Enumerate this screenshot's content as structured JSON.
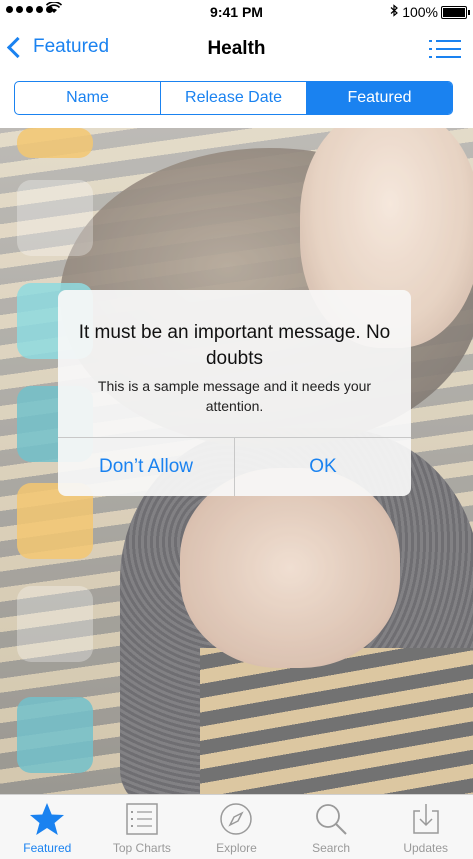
{
  "status_bar": {
    "time": "9:41 PM",
    "battery": "100%"
  },
  "nav": {
    "back_label": "Featured",
    "title": "Health"
  },
  "segments": [
    "Name",
    "Release Date",
    "Featured"
  ],
  "alert": {
    "title": "It must be an important message. No doubts",
    "message": "This is a sample message and it needs your attention.",
    "cancel_label": "Don’t Allow",
    "ok_label": "OK"
  },
  "tabbar": {
    "items": [
      {
        "label": "Featured",
        "icon": "star-icon"
      },
      {
        "label": "Top Charts",
        "icon": "list-icon"
      },
      {
        "label": "Explore",
        "icon": "compass-icon"
      },
      {
        "label": "Search",
        "icon": "search-icon"
      },
      {
        "label": "Updates",
        "icon": "download-icon"
      }
    ]
  },
  "colors": {
    "accent": "#1a82f0",
    "inactive": "#9a9a9a"
  }
}
